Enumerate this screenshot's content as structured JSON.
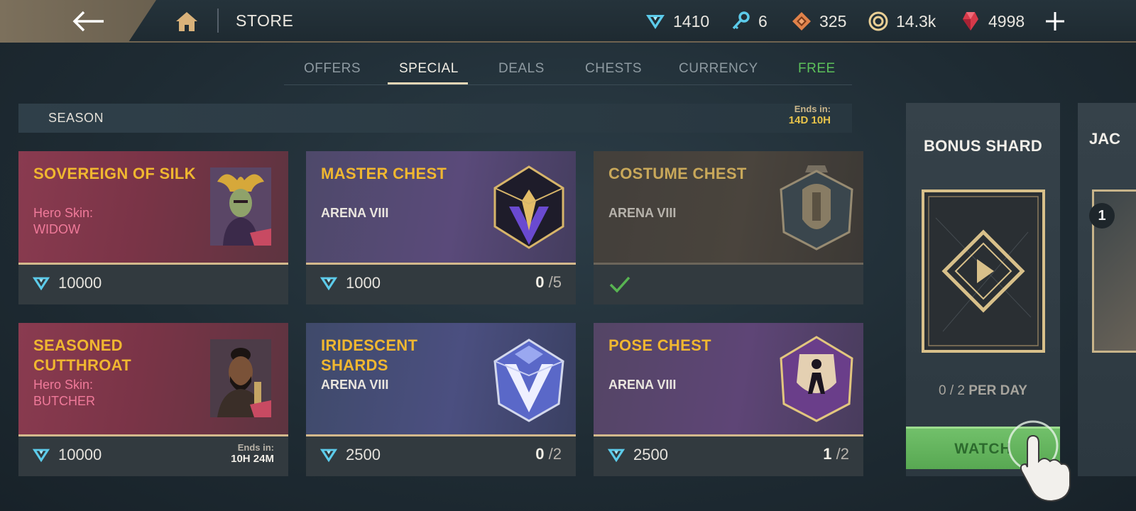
{
  "header": {
    "title": "STORE",
    "currencies": {
      "shards": "1410",
      "keys": "6",
      "tokens": "325",
      "coins": "14.3k",
      "gems": "4998"
    }
  },
  "tabs": [
    {
      "label": "OFFERS",
      "color": "#8e9aa1"
    },
    {
      "label": "SPECIAL",
      "color": "#f1ede4"
    },
    {
      "label": "DEALS",
      "color": "#8e9aa1"
    },
    {
      "label": "CHESTS",
      "color": "#8e9aa1"
    },
    {
      "label": "CURRENCY",
      "color": "#8e9aa1"
    },
    {
      "label": "FREE",
      "color": "#5cc05a"
    }
  ],
  "season": {
    "label": "SEASON",
    "ends_label": "Ends in:",
    "ends_value": "14D 10H"
  },
  "cards": [
    {
      "name": "SOVEREIGN OF SILK",
      "sub1": "Hero Skin:",
      "sub2": "WIDOW",
      "price": "10000"
    },
    {
      "name": "MASTER CHEST",
      "sub": "ARENA VIII",
      "price": "1000",
      "count_have": "0",
      "count_max": "/5"
    },
    {
      "name": "COSTUME CHEST",
      "sub": "ARENA VIII"
    },
    {
      "name": "SEASONED CUTTHROAT",
      "sub1": "Hero Skin:",
      "sub2": "BUTCHER",
      "price": "10000",
      "ends_label": "Ends in:",
      "ends_value": "10H 24M"
    },
    {
      "name": "IRIDESCENT SHARDS",
      "sub": "ARENA VIII",
      "price": "2500",
      "count_have": "0",
      "count_max": "/2"
    },
    {
      "name": "POSE CHEST",
      "sub": "ARENA VIII",
      "price": "2500",
      "count_have": "1",
      "count_max": "/2"
    }
  ],
  "bonus": {
    "title": "BONUS SHARD",
    "count": "0 / 2",
    "per_day": "PER DAY",
    "watch_label": "WATCH"
  },
  "next_panel": {
    "title": "JAC",
    "badge": "1"
  }
}
